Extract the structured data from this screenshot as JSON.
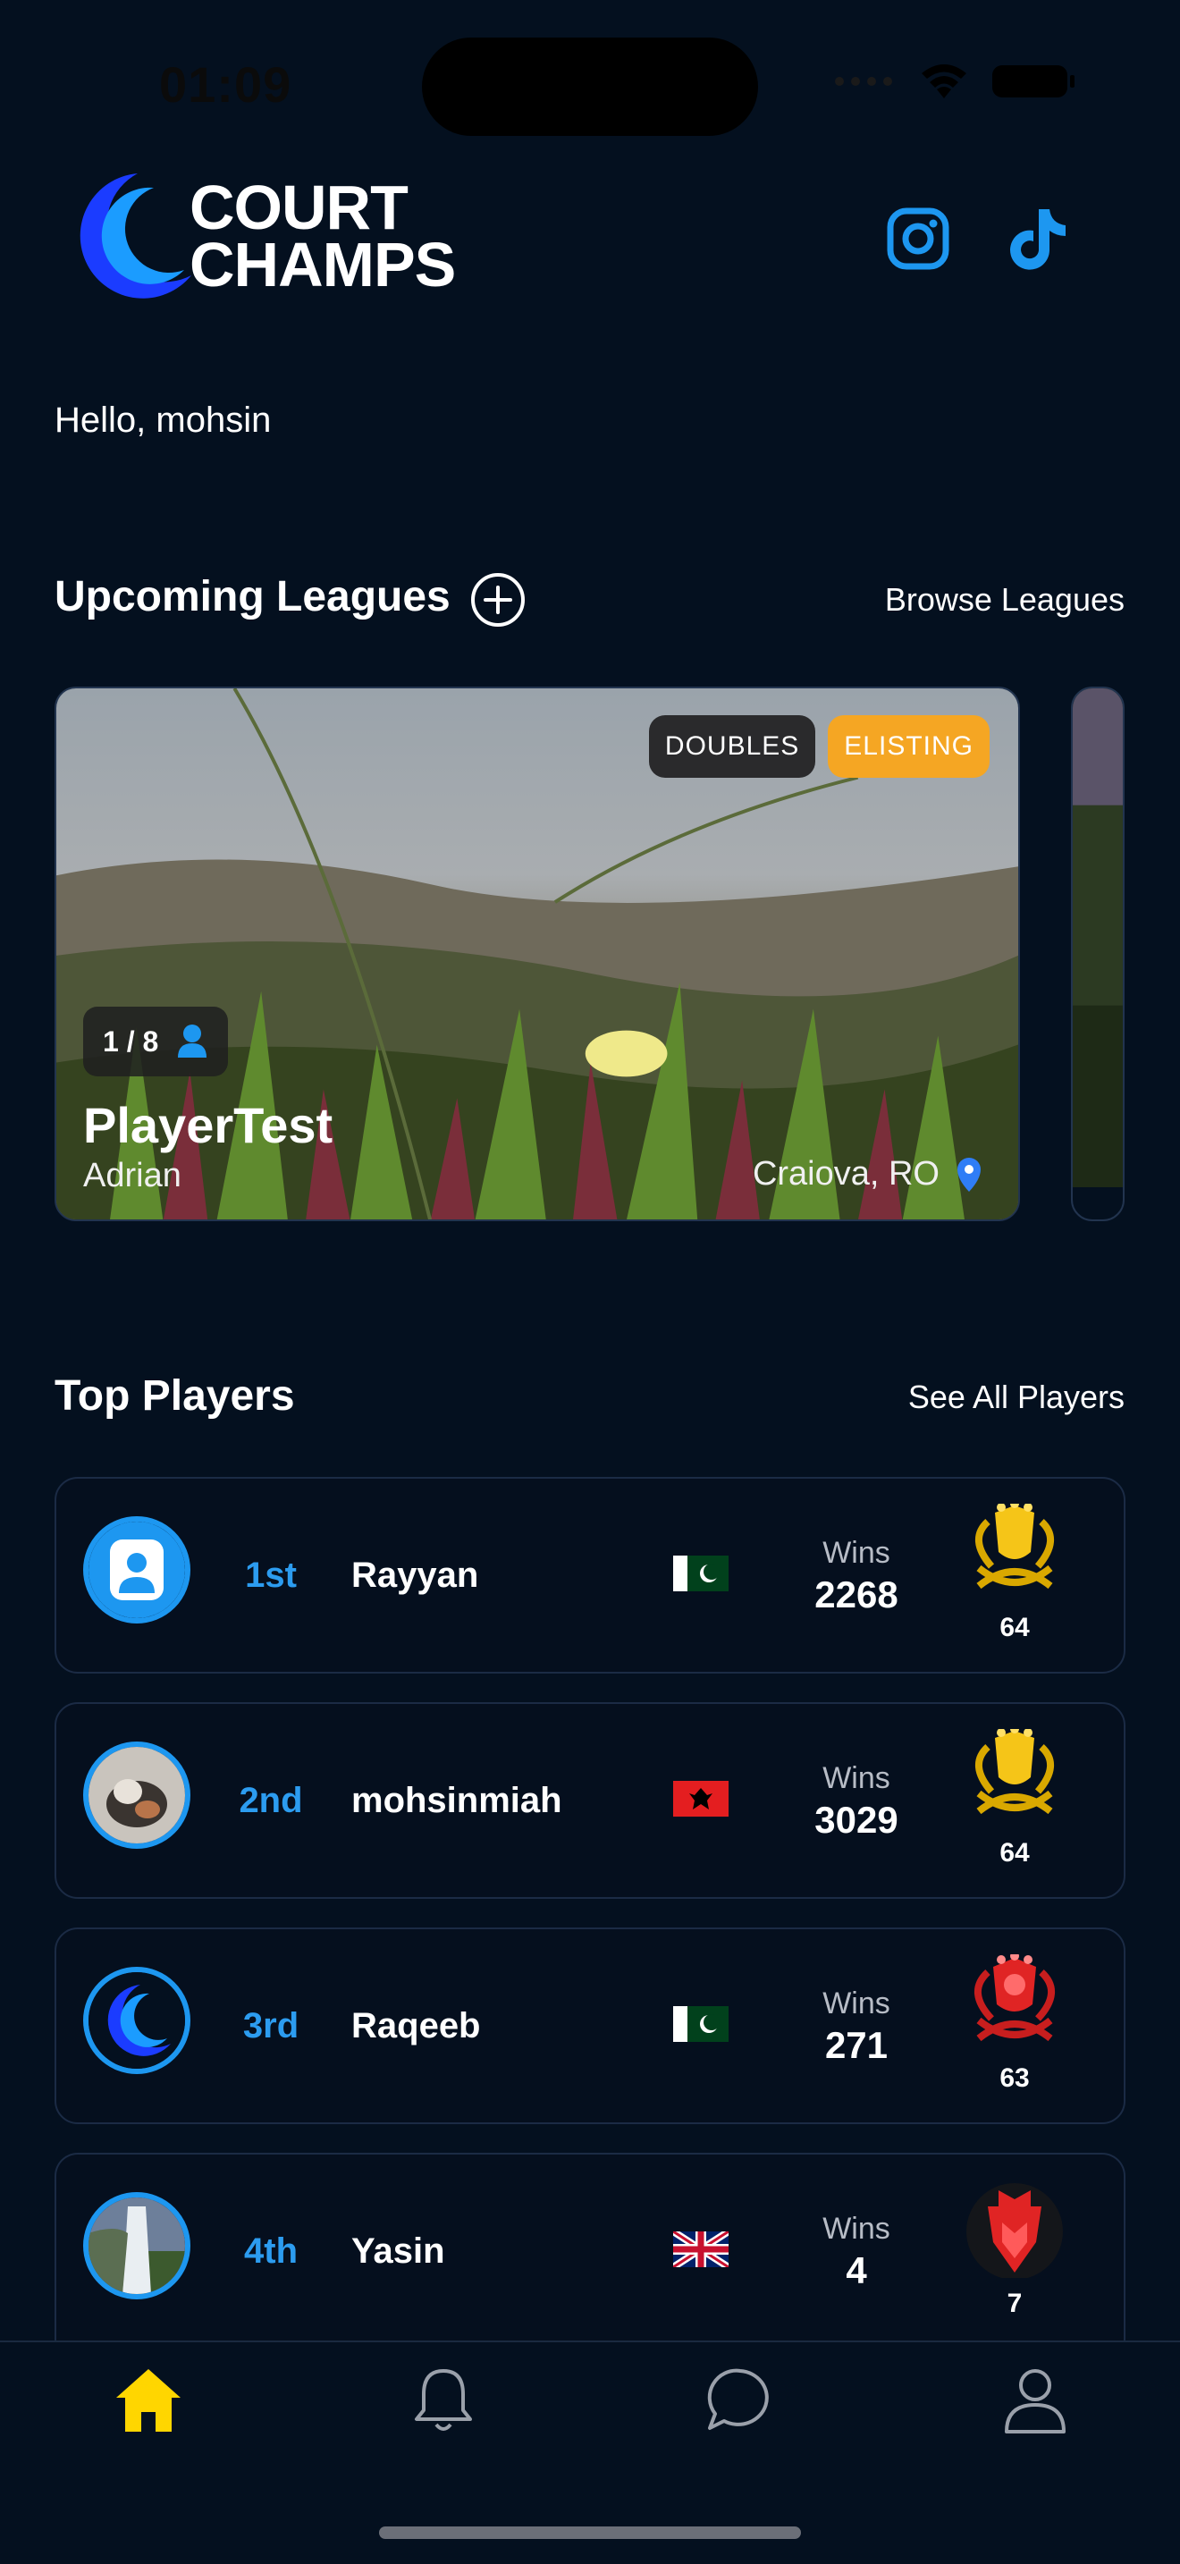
{
  "status_bar": {
    "time": "01:09"
  },
  "header": {
    "logo_line1": "COURT",
    "logo_line2": "CHAMPS",
    "social": [
      "instagram-icon",
      "tiktok-icon"
    ]
  },
  "greeting": "Hello, mohsin",
  "upcoming": {
    "title": "Upcoming Leagues",
    "browse_label": "Browse Leagues",
    "leagues": [
      {
        "tag1": "DOUBLES",
        "tag2": "ELISTING",
        "players": "1 / 8",
        "name": "PlayerTest",
        "owner": "Adrian",
        "location": "Craiova, RO"
      }
    ]
  },
  "top_players": {
    "title": "Top Players",
    "see_all_label": "See All Players",
    "wins_label": "Wins",
    "players": [
      {
        "rank": "1st",
        "name": "Rayyan",
        "country": "Pakistan",
        "wins": "2268",
        "level": "64",
        "trophy": "gold"
      },
      {
        "rank": "2nd",
        "name": "mohsinmiah",
        "country": "Albania",
        "wins": "3029",
        "level": "64",
        "trophy": "gold"
      },
      {
        "rank": "3rd",
        "name": "Raqeeb",
        "country": "Pakistan",
        "wins": "271",
        "level": "63",
        "trophy": "red"
      },
      {
        "rank": "4th",
        "name": "Yasin",
        "country": "United Kingdom",
        "wins": "4",
        "level": "7",
        "trophy": "red-shield"
      }
    ]
  },
  "nav": {
    "items": [
      "home-icon",
      "bell-icon",
      "chat-icon",
      "profile-icon"
    ],
    "active": "home-icon",
    "active_color": "#ffd600"
  },
  "colors": {
    "accent": "#1d97f0",
    "background": "#04101f",
    "listing": "#f5a623"
  }
}
